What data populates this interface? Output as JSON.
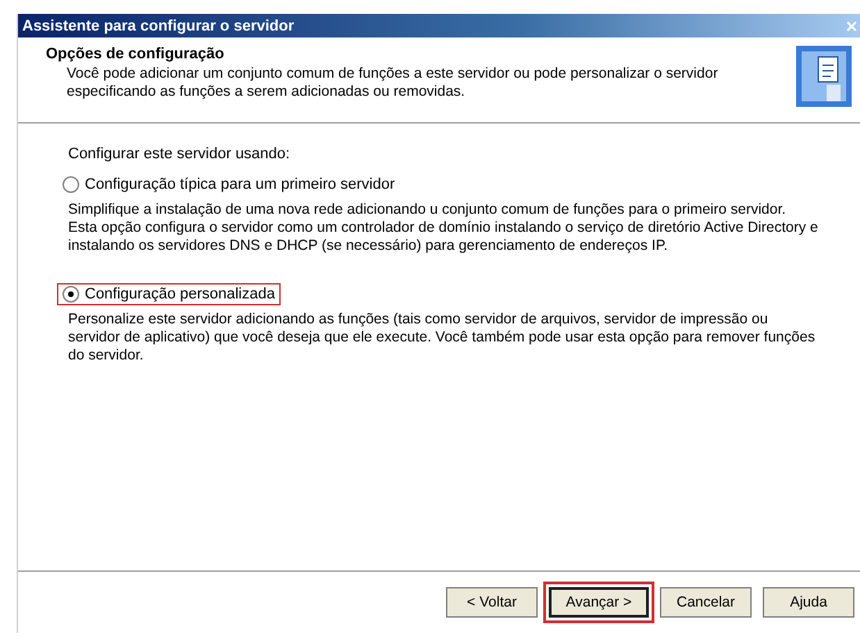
{
  "window": {
    "title": "Assistente para configurar o servidor"
  },
  "header": {
    "title": "Opções de configuração",
    "description": "Você pode adicionar um conjunto comum de funções a este servidor ou pode personalizar o servidor especificando as funções a serem adicionadas ou removidas."
  },
  "prompt": "Configurar este servidor usando:",
  "options": [
    {
      "label": "Configuração típica para um primeiro servidor",
      "selected": false,
      "highlighted": false,
      "description": "Simplifique a instalação de uma nova rede adicionando u conjunto comum de funções para o primeiro servidor. Esta opção configura o servidor como um controlador de domínio instalando o serviço de diretório Active Directory e instalando os servidores DNS e DHCP (se necessário) para gerenciamento de endereços IP."
    },
    {
      "label": "Configuração personalizada",
      "selected": true,
      "highlighted": true,
      "description": "Personalize este servidor adicionando as funções (tais como servidor de arquivos, servidor de impressão ou servidor de aplicativo) que você deseja que ele execute. Você também pode usar esta opção para remover funções do servidor."
    }
  ],
  "buttons": [
    {
      "label": "< Voltar",
      "highlighted": false,
      "default": false
    },
    {
      "label": "Avançar >",
      "highlighted": true,
      "default": true
    },
    {
      "label": "Cancelar",
      "highlighted": false,
      "default": false
    },
    {
      "label": "Ajuda",
      "highlighted": false,
      "default": false
    }
  ]
}
